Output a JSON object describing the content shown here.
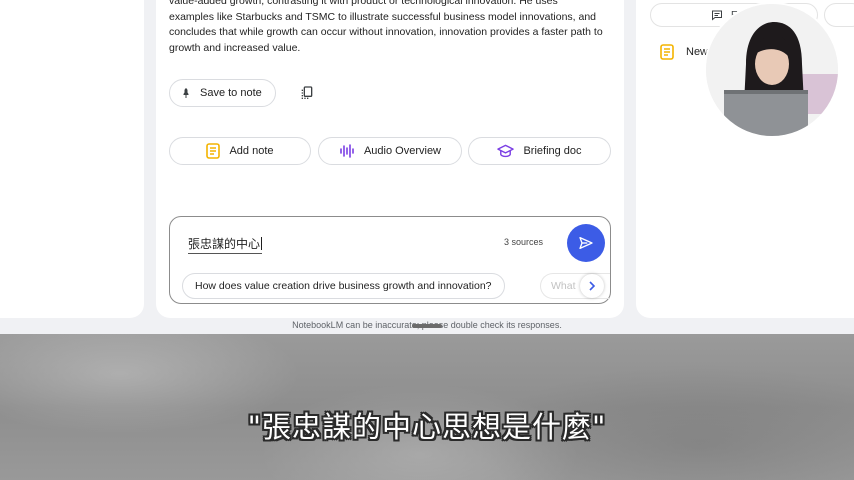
{
  "response": {
    "lines": [
      "value-added growth, contrasting it with product or technological innovation. He uses",
      "examples like Starbucks and TSMC to illustrate successful business model innovations, and",
      "concludes that while growth can occur without innovation, innovation provides a faster path to",
      "growth and increased value."
    ]
  },
  "actions": {
    "save_to_note": "Save to note",
    "add_note": "Add note",
    "audio_overview": "Audio Overview",
    "briefing_doc": "Briefing doc"
  },
  "composer": {
    "input_value": "張忠謀的中心",
    "sources_count": "3 sources",
    "suggestion_1": "How does value creation drive business growth and innovation?",
    "suggestion_2": "What"
  },
  "footer": {
    "disclaimer": "NotebookLM can be inaccurate; please double check its responses."
  },
  "notes_panel": {
    "tab_label": "E",
    "new_note": "New"
  },
  "subtitle": {
    "text": "\"張忠謀的中心思想是什麼\""
  },
  "colors": {
    "send_button": "#3c5ce6",
    "note_icon": "#f4b400",
    "accent_purple": "#7b3fe4"
  }
}
